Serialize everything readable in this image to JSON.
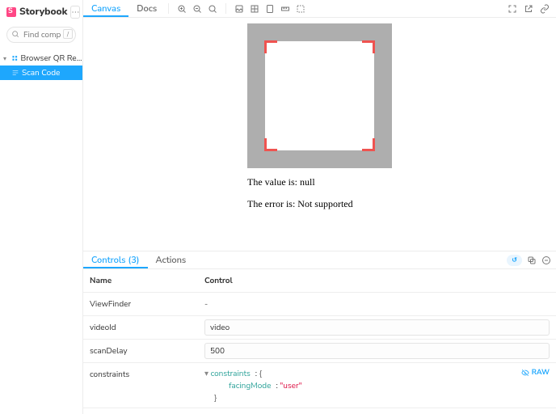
{
  "brand": "Storybook",
  "search": {
    "placeholder": "Find components"
  },
  "tree": {
    "group": "Browser QR Reader",
    "story": "Scan Code"
  },
  "tabs": {
    "canvas": "Canvas",
    "docs": "Docs"
  },
  "preview": {
    "value_line": "The value is: null",
    "error_line": "The error is: Not supported"
  },
  "addons": {
    "controls_label": "Controls",
    "controls_count": "(3)",
    "actions_label": "Actions",
    "reset_chip": "↺"
  },
  "columns": {
    "name": "Name",
    "control": "Control"
  },
  "rows": {
    "viewfinder": {
      "name": "ViewFinder",
      "value": "-"
    },
    "videoId": {
      "name": "videoId",
      "value": "video"
    },
    "scanDelay": {
      "name": "scanDelay",
      "value": "500"
    },
    "constraints": {
      "name": "constraints",
      "raw_label": "RAW",
      "json": {
        "root_key": "constraints",
        "child_key": "facingMode",
        "child_val": "\"user\""
      }
    }
  }
}
